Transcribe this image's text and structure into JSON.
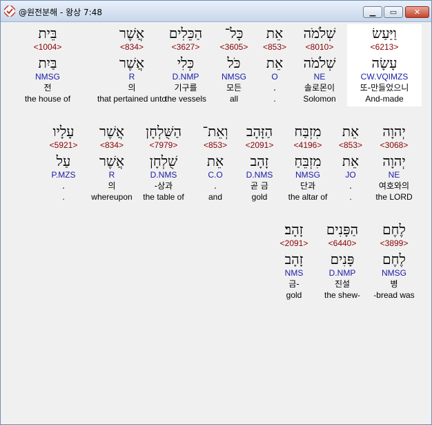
{
  "window": {
    "title": "@원전분해 - 왕상 7:48",
    "icon": "app-check-icon"
  },
  "rows": [
    {
      "words": [
        {
          "hebrew": "וַיַּעַשׂ",
          "strong": "<6213>",
          "lemma": "עָשָׂה",
          "morph": "CW.VQIMZS",
          "korean": "또-만들었으니",
          "english": "And-made",
          "highlighted": true
        },
        {
          "hebrew": "שְׁלֹמֹה",
          "strong": "<8010>",
          "lemma": "שְׁלֹמֹה",
          "morph": "NE",
          "korean": "솔로몬이",
          "english": "Solomon"
        },
        {
          "hebrew": "אֵת",
          "strong": "<853>",
          "lemma": "אֵת",
          "morph": "O",
          "korean": ".",
          "english": "."
        },
        {
          "hebrew": "כָּל־",
          "strong": "<3605>",
          "lemma": "כֹּל",
          "morph": "NMSG",
          "korean": "모든",
          "english": "all"
        },
        {
          "hebrew": "הַכֵּלִים",
          "strong": "<3627>",
          "lemma": "כְּלִי",
          "morph": "D.NMP",
          "korean": "기구를",
          "english": "the vessels"
        },
        {
          "hebrew": "אֲשֶׁר",
          "strong": "<834>",
          "lemma": "אֲשֶׁר",
          "morph": "R",
          "korean": "의",
          "english": "that pertained unto"
        },
        {
          "hebrew": "בֵּית",
          "strong": "<1004>",
          "lemma": "בַּיִת",
          "morph": "NMSG",
          "korean": "전",
          "english": "the house of"
        }
      ]
    },
    {
      "words": [
        {
          "hebrew": "יְהוָה",
          "strong": "<3068>",
          "lemma": "יְהוָה",
          "morph": "NE",
          "korean": "여호와의",
          "english": "the LORD"
        },
        {
          "hebrew": "אֵת",
          "strong": "<853>",
          "lemma": "אֵת",
          "morph": "JO",
          "korean": ".",
          "english": "."
        },
        {
          "hebrew": "מִזְבַּח",
          "strong": "<4196>",
          "lemma": "מִזְבֵּחַ",
          "morph": "NMSG",
          "korean": "단과",
          "english": "the altar of"
        },
        {
          "hebrew": "הַזָּהָב",
          "strong": "<2091>",
          "lemma": "זָהָב",
          "morph": "D.NMS",
          "korean": "곧 금",
          "english": "gold"
        },
        {
          "hebrew": "וְאֵת־",
          "strong": "<853>",
          "lemma": "אֵת",
          "morph": "C.O",
          "korean": ".",
          "english": "and"
        },
        {
          "hebrew": "הַשֻּׁלְחָן",
          "strong": "<7979>",
          "lemma": "שֻׁלְחָן",
          "morph": "D.NMS",
          "korean": "-상과",
          "english": "the table of"
        },
        {
          "hebrew": "אֲשֶׁר",
          "strong": "<834>",
          "lemma": "אֲשֶׁר",
          "morph": "R",
          "korean": "의",
          "english": "whereupon"
        },
        {
          "hebrew": "עָלָיו",
          "strong": "<5921>",
          "lemma": "עַל",
          "morph": "P.MZS",
          "korean": ".",
          "english": "."
        }
      ]
    },
    {
      "words": [
        {
          "hebrew": "לֶחֶם",
          "strong": "<3899>",
          "lemma": "לֶחֶם",
          "morph": "NMSG",
          "korean": "병",
          "english": "-bread was"
        },
        {
          "hebrew": "הַפָּנִים",
          "strong": "<6440>",
          "lemma": "פָּנִים",
          "morph": "D.NMP",
          "korean": "진설",
          "english": "the shew-"
        },
        {
          "hebrew": "זָהָב׃",
          "strong": "<2091>",
          "lemma": "זָהָב",
          "morph": "NMS",
          "korean": "금-",
          "english": "gold"
        }
      ]
    }
  ]
}
